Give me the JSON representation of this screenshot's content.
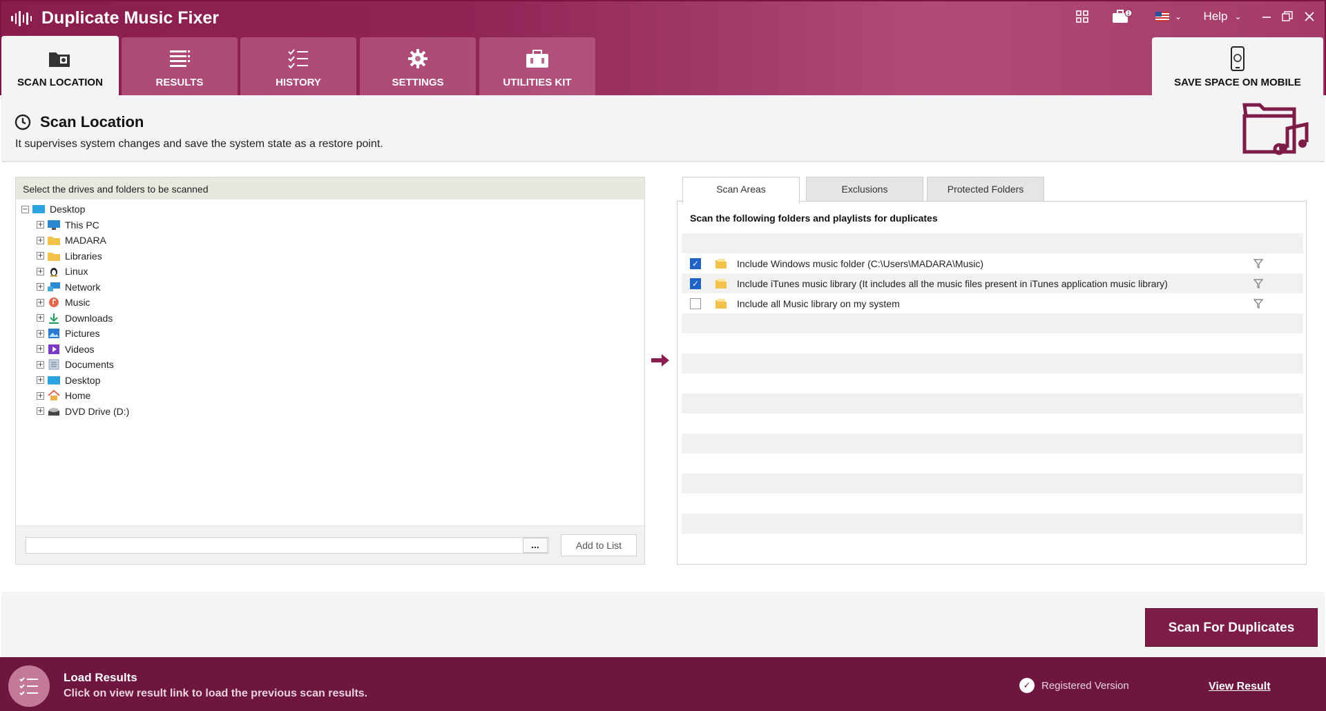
{
  "app": {
    "title": "Duplicate Music Fixer"
  },
  "titlebar": {
    "help_label": "Help"
  },
  "tabs": [
    {
      "label": "SCAN LOCATION",
      "icon": "scan-location-icon",
      "active": true
    },
    {
      "label": "RESULTS",
      "icon": "results-list-icon",
      "active": false
    },
    {
      "label": "HISTORY",
      "icon": "history-checklist-icon",
      "active": false
    },
    {
      "label": "SETTINGS",
      "icon": "gear-icon",
      "active": false
    },
    {
      "label": "UTILITIES KIT",
      "icon": "toolkit-icon",
      "active": false
    }
  ],
  "mobile_tab": {
    "label": "SAVE SPACE ON MOBILE",
    "icon": "mobile-phone-icon"
  },
  "page": {
    "title": "Scan Location",
    "description": "It supervises system changes and save the system state as a restore point."
  },
  "left_panel": {
    "header": "Select the drives and folders to be scanned",
    "tree": [
      {
        "label": "Desktop",
        "expanded": true,
        "level": 0,
        "icon": "desktop-icon"
      },
      {
        "label": "This PC",
        "level": 1,
        "icon": "monitor-icon"
      },
      {
        "label": "MADARA",
        "level": 1,
        "icon": "folder-icon"
      },
      {
        "label": "Libraries",
        "level": 1,
        "icon": "folder-icon"
      },
      {
        "label": "Linux",
        "level": 1,
        "icon": "linux-penguin-icon"
      },
      {
        "label": "Network",
        "level": 1,
        "icon": "network-icon"
      },
      {
        "label": "Music",
        "level": 1,
        "icon": "music-icon"
      },
      {
        "label": "Downloads",
        "level": 1,
        "icon": "download-icon"
      },
      {
        "label": "Pictures",
        "level": 1,
        "icon": "pictures-icon"
      },
      {
        "label": "Videos",
        "level": 1,
        "icon": "video-icon"
      },
      {
        "label": "Documents",
        "level": 1,
        "icon": "document-icon"
      },
      {
        "label": "Desktop",
        "level": 1,
        "icon": "desktop-icon"
      },
      {
        "label": "Home",
        "level": 1,
        "icon": "home-icon"
      },
      {
        "label": "DVD Drive (D:)",
        "level": 1,
        "icon": "dvd-drive-icon"
      }
    ],
    "path_value": "",
    "browse_label": "...",
    "add_button": "Add to List"
  },
  "right_panel": {
    "tabs": [
      "Scan Areas",
      "Exclusions",
      "Protected Folders"
    ],
    "active_tab": "Scan Areas",
    "heading": "Scan the following folders and playlists for duplicates",
    "items": [
      {
        "label": "Include Windows music folder (C:\\Users\\MADARA\\Music)",
        "checked": true
      },
      {
        "label": "Include iTunes music library (It includes all the music files present in iTunes application music library)",
        "checked": true
      },
      {
        "label": "Include all Music library on my system",
        "checked": false
      }
    ]
  },
  "scan_button": "Scan For Duplicates",
  "footer": {
    "title": "Load Results",
    "description": "Click on view result link to load the previous scan results.",
    "status": "Registered Version",
    "link": "View Result"
  },
  "colors": {
    "brand": "#8a1d4d",
    "footer": "#6e1640",
    "button": "#7e1c48",
    "checkbox": "#1f63c7"
  }
}
